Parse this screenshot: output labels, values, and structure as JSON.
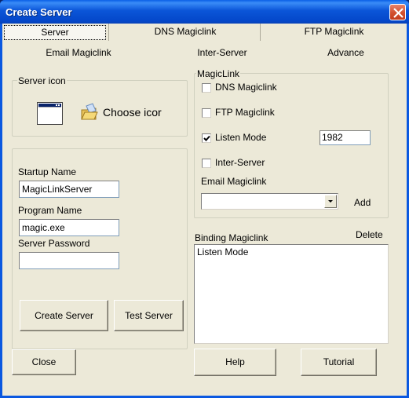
{
  "window": {
    "title": "Create Server",
    "close_icon": "close-x-icon"
  },
  "tabs": [
    {
      "label": "Server",
      "selected": true
    },
    {
      "label": "DNS Magiclink"
    },
    {
      "label": "FTP Magiclink"
    },
    {
      "label": "Email Magiclink"
    },
    {
      "label": "Inter-Server"
    },
    {
      "label": "Advance"
    }
  ],
  "server_icon": {
    "legend": "Server icon",
    "preview_icon": "window-icon",
    "choose_icon": "folder-open-icon",
    "choose_label": "Choose icor"
  },
  "form": {
    "startup_name_label": "Startup Name",
    "startup_name_value": "MagicLinkServer",
    "program_name_label": "Program Name",
    "program_name_value": "magic.exe",
    "server_password_label": "Server Password",
    "server_password_value": "",
    "create_button": "Create Server",
    "test_button": "Test Server"
  },
  "close_button": "Close",
  "magiclink": {
    "legend": "MagicLink",
    "options": [
      {
        "label": "DNS Magiclink",
        "checked": false
      },
      {
        "label": "FTP Magiclink",
        "checked": false
      },
      {
        "label": "Listen Mode",
        "checked": true
      },
      {
        "label": "Inter-Server",
        "checked": false
      }
    ],
    "listen_port": "1982",
    "email_label": "Email Magiclink",
    "email_selected": "",
    "add_label": "Add"
  },
  "binding": {
    "label": "Binding Magiclink",
    "delete_label": "Delete",
    "items": [
      "Listen Mode"
    ]
  },
  "help_button": "Help",
  "tutorial_button": "Tutorial"
}
